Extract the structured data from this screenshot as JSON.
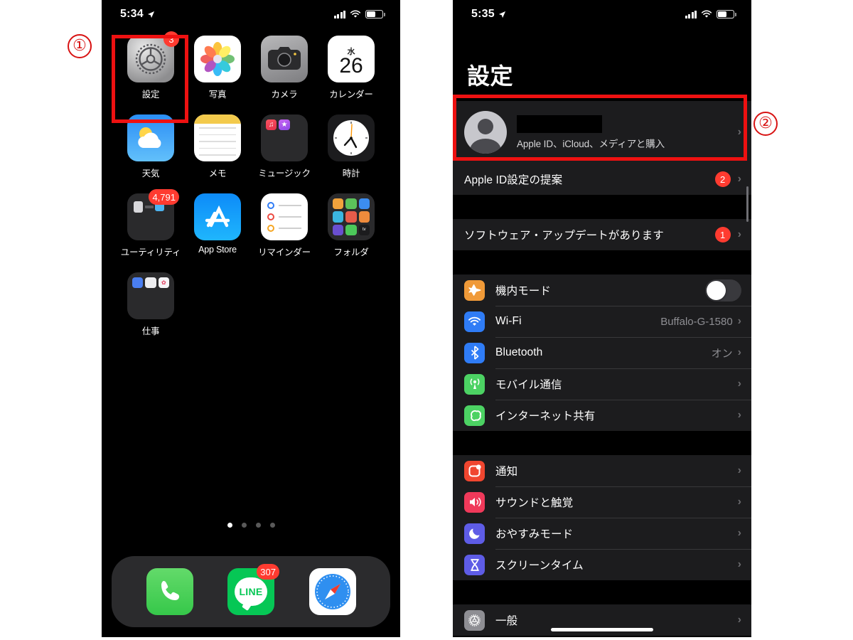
{
  "annotations": {
    "markers": [
      {
        "name": "step-one",
        "label": "①"
      },
      {
        "name": "step-two",
        "label": "②"
      }
    ],
    "highlight_color": "#ee1111"
  },
  "home_screen": {
    "status_bar": {
      "time": "5:34",
      "location_icon": "location-arrow-icon",
      "signal_icon": "cellular-signal-icon",
      "wifi_icon": "wifi-icon",
      "battery_icon": "battery-icon"
    },
    "apps": [
      {
        "label": "設定",
        "icon": "settings-gear-icon",
        "badge": "3"
      },
      {
        "label": "写真",
        "icon": "photos-icon",
        "badge": ""
      },
      {
        "label": "カメラ",
        "icon": "camera-icon",
        "badge": ""
      },
      {
        "label": "カレンダー",
        "icon": "calendar-icon",
        "badge": "",
        "calendar_dow": "水",
        "calendar_day": "26"
      },
      {
        "label": "天気",
        "icon": "weather-icon",
        "badge": ""
      },
      {
        "label": "メモ",
        "icon": "notes-icon",
        "badge": ""
      },
      {
        "label": "ミュージック",
        "icon": "music-folder-icon",
        "badge": ""
      },
      {
        "label": "時計",
        "icon": "clock-icon",
        "badge": ""
      },
      {
        "label": "ユーティリティ",
        "icon": "utilities-folder-icon",
        "badge": "4,791"
      },
      {
        "label": "App Store",
        "icon": "app-store-icon",
        "badge": ""
      },
      {
        "label": "リマインダー",
        "icon": "reminders-icon",
        "badge": ""
      },
      {
        "label": "フォルダ",
        "icon": "folder-icon",
        "badge": ""
      },
      {
        "label": "仕事",
        "icon": "work-folder-icon",
        "badge": ""
      }
    ],
    "page_dots": {
      "count": 4,
      "active_index": 0
    },
    "dock": [
      {
        "label": "Phone",
        "icon": "phone-icon",
        "badge": ""
      },
      {
        "label": "LINE",
        "icon": "line-icon",
        "badge": "307",
        "wordmark": "LINE"
      },
      {
        "label": "Safari",
        "icon": "safari-compass-icon",
        "badge": ""
      }
    ]
  },
  "settings_screen": {
    "status_bar": {
      "time": "5:35",
      "location_icon": "location-arrow-icon",
      "signal_icon": "cellular-signal-icon",
      "wifi_icon": "wifi-icon",
      "battery_icon": "battery-icon"
    },
    "title": "設定",
    "apple_id": {
      "name_redacted": "",
      "subtitle": "Apple ID、iCloud、メディアと購入",
      "chevron": "›"
    },
    "suggestion_row": {
      "label": "Apple ID設定の提案",
      "badge": "2",
      "chevron": "›"
    },
    "update_row": {
      "label": "ソフトウェア・アップデートがあります",
      "badge": "1",
      "chevron": "›"
    },
    "connectivity_group": [
      {
        "label": "機内モード",
        "icon": "airplane-icon",
        "icon_color": "#f09a38",
        "control": "toggle",
        "toggle_on": false
      },
      {
        "label": "Wi-Fi",
        "icon": "wifi-icon",
        "icon_color": "#2f7cf6",
        "control": "value",
        "value": "Buffalo-G-1580",
        "chevron": "›"
      },
      {
        "label": "Bluetooth",
        "icon": "bluetooth-icon",
        "icon_color": "#2f7cf6",
        "control": "value",
        "value": "オン",
        "chevron": "›"
      },
      {
        "label": "モバイル通信",
        "icon": "cellular-icon",
        "icon_color": "#4cd263",
        "control": "chevron",
        "chevron": "›"
      },
      {
        "label": "インターネット共有",
        "icon": "hotspot-icon",
        "icon_color": "#4cd263",
        "control": "chevron",
        "chevron": "›"
      }
    ],
    "notification_group": [
      {
        "label": "通知",
        "icon": "notifications-icon",
        "icon_color": "#f0462f",
        "control": "chevron",
        "chevron": "›"
      },
      {
        "label": "サウンドと触覚",
        "icon": "sound-haptics-icon",
        "icon_color": "#f0395a",
        "control": "chevron",
        "chevron": "›"
      },
      {
        "label": "おやすみモード",
        "icon": "do-not-disturb-moon-icon",
        "icon_color": "#5e5ce6",
        "control": "chevron",
        "chevron": "›"
      },
      {
        "label": "スクリーンタイム",
        "icon": "screen-time-hourglass-icon",
        "icon_color": "#5e5ce6",
        "control": "chevron",
        "chevron": "›"
      }
    ],
    "general_group": [
      {
        "label": "一般",
        "icon": "general-gear-icon",
        "icon_color": "#8e8e93",
        "control": "chevron",
        "chevron": "›"
      }
    ]
  }
}
